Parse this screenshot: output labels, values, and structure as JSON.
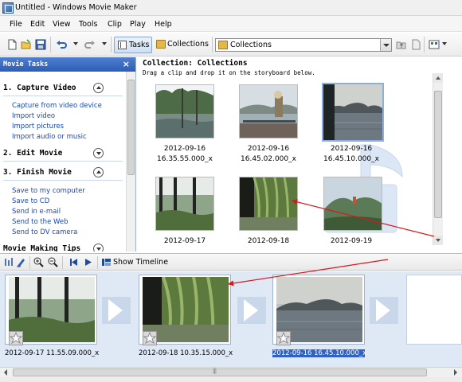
{
  "window": {
    "title": "Untitled - Windows Movie Maker",
    "app_icon": "movie-maker-icon"
  },
  "menu": [
    "File",
    "Edit",
    "View",
    "Tools",
    "Clip",
    "Play",
    "Help"
  ],
  "toolbar": {
    "tasks_label": "Tasks",
    "collections_label": "Collections",
    "collection_selected": "Collections",
    "icons": [
      "new-project-icon",
      "open-folder-icon",
      "save-icon",
      "undo-icon",
      "redo-icon",
      "up-folder-icon",
      "new-folder-icon",
      "views-icon"
    ]
  },
  "taskpane": {
    "header": "Movie Tasks",
    "sections": [
      {
        "title": "1. Capture Video",
        "links": [
          "Capture from video device",
          "Import video",
          "Import pictures",
          "Import audio or music"
        ]
      },
      {
        "title": "2. Edit Movie",
        "links": []
      },
      {
        "title": "3. Finish Movie",
        "links": [
          "Save to my computer",
          "Save to CD",
          "Send in e-mail",
          "Send to the Web",
          "Send to DV camera"
        ]
      },
      {
        "title": "Movie Making Tips",
        "links": []
      }
    ]
  },
  "collection": {
    "heading": "Collection: Collections",
    "instruction": "Drag a clip and drop it on the storyboard below.",
    "clips": [
      {
        "date": "2012-09-16",
        "time": "16.35.55.000_x"
      },
      {
        "date": "2012-09-16",
        "time": "16.45.02.000_x"
      },
      {
        "date": "2012-09-16",
        "time": "16.45.10.000_x"
      },
      {
        "date": "2012-09-17",
        "time": ""
      },
      {
        "date": "2012-09-18",
        "time": ""
      },
      {
        "date": "2012-09-19",
        "time": ""
      }
    ]
  },
  "storyboard": {
    "show_timeline_label": "Show Timeline",
    "clips": [
      {
        "label": "2012-09-17 11.55.09.000_x"
      },
      {
        "label": "2012-09-18 10.35.15.000_x"
      },
      {
        "label": "2012-09-16 16.45.10.000_x"
      }
    ]
  },
  "colors": {
    "accent": "#2c5db6",
    "link": "#1a47b5",
    "selection": "#3062c4",
    "annotation": "#d6191c"
  }
}
